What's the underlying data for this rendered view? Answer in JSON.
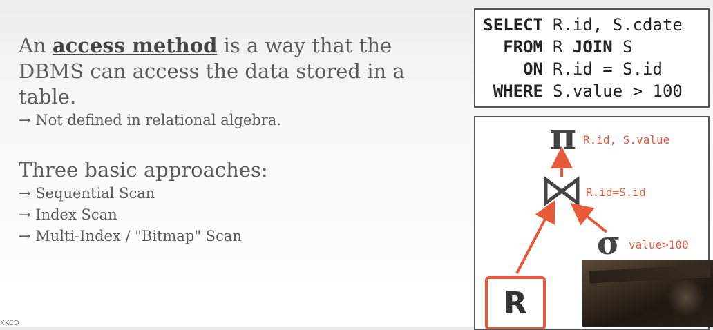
{
  "intro": {
    "prefix": "An ",
    "keyword": "access method",
    "suffix": " is a way that the DBMS can access the data stored in a table.",
    "note": "→ Not defined in relational algebra."
  },
  "approaches": {
    "heading": "Three basic approaches:",
    "items": [
      "→ Sequential Scan",
      "→ Index Scan",
      "→ Multi-Index / \"Bitmap\" Scan"
    ]
  },
  "sql": {
    "lines": [
      {
        "kw": "SELECT",
        "text": "R.id, S.cdate"
      },
      {
        "kw": "FROM",
        "text": "R JOIN S"
      },
      {
        "kw": "ON",
        "text": "R.id = S.id"
      },
      {
        "kw": "WHERE",
        "text": "S.value > 100"
      }
    ]
  },
  "plan": {
    "projection": {
      "symbol": "π",
      "label": "R.id, S.value"
    },
    "join": {
      "label": "R.id=S.id"
    },
    "selection": {
      "symbol": "σ",
      "label": "value>100"
    },
    "relation_r": "R"
  },
  "footer": "XKCD",
  "colors": {
    "accent": "#e8593a",
    "text": "#5a5a5a",
    "border": "#555555"
  }
}
